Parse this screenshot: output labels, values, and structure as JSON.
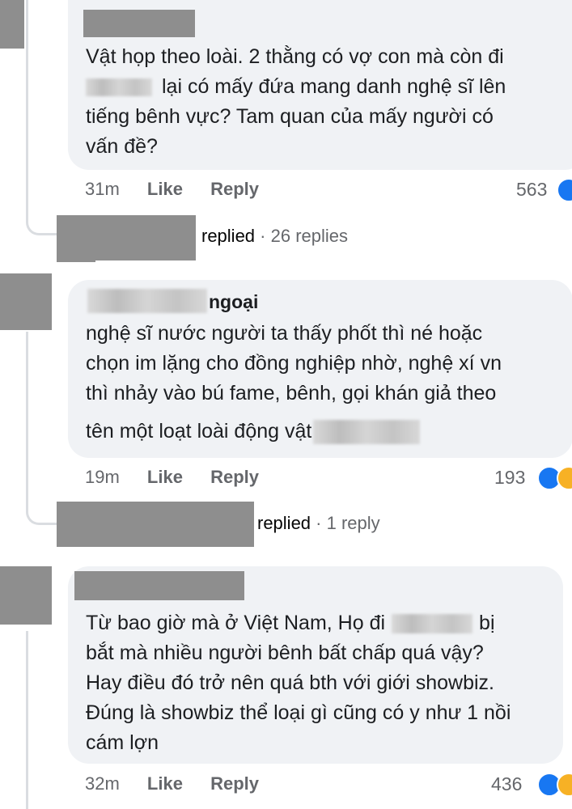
{
  "comments": [
    {
      "body_lines": [
        "Vật họp theo loài. 2 thằng có vợ con mà còn đi",
        "lại có mấy đứa mang danh nghệ sĩ lên",
        "tiếng bênh vực? Tam quan của mấy người có",
        "vấn đề?"
      ],
      "time": "31m",
      "like": "Like",
      "reply": "Reply",
      "count": "563",
      "replies_label": "replied",
      "replies_count": "· 26 replies"
    },
    {
      "author_suffix": "ngoại",
      "body_lines": [
        "nghệ sĩ nước người ta thấy phốt thì né hoặc",
        "chọn im lặng cho đồng nghiệp nhờ, nghệ xí vn",
        "thì nhảy vào bú fame, bênh, gọi khán giả theo",
        "tên một loạt loài động vật"
      ],
      "time": "19m",
      "like": "Like",
      "reply": "Reply",
      "count": "193",
      "replies_label": "replied",
      "replies_count": "· 1 reply"
    },
    {
      "body_lines": [
        "Từ bao giờ mà ở Việt Nam, Họ đi",
        "bị",
        "bắt mà nhiều người bênh bất chấp quá vậy?",
        "Hay điều đó trở nên quá bth với giới showbiz.",
        "Đúng là showbiz thể loại gì cũng có y như 1 nồi",
        "cám lợn"
      ],
      "time": "32m",
      "like": "Like",
      "reply": "Reply",
      "count": "436"
    }
  ],
  "colors": {
    "bubble": "#f0f2f5",
    "meta": "#65676b",
    "like_blue": "#1877f2",
    "haha_yellow": "#f7b125"
  },
  "icons": [
    "like-reaction-icon",
    "haha-reaction-icon"
  ]
}
